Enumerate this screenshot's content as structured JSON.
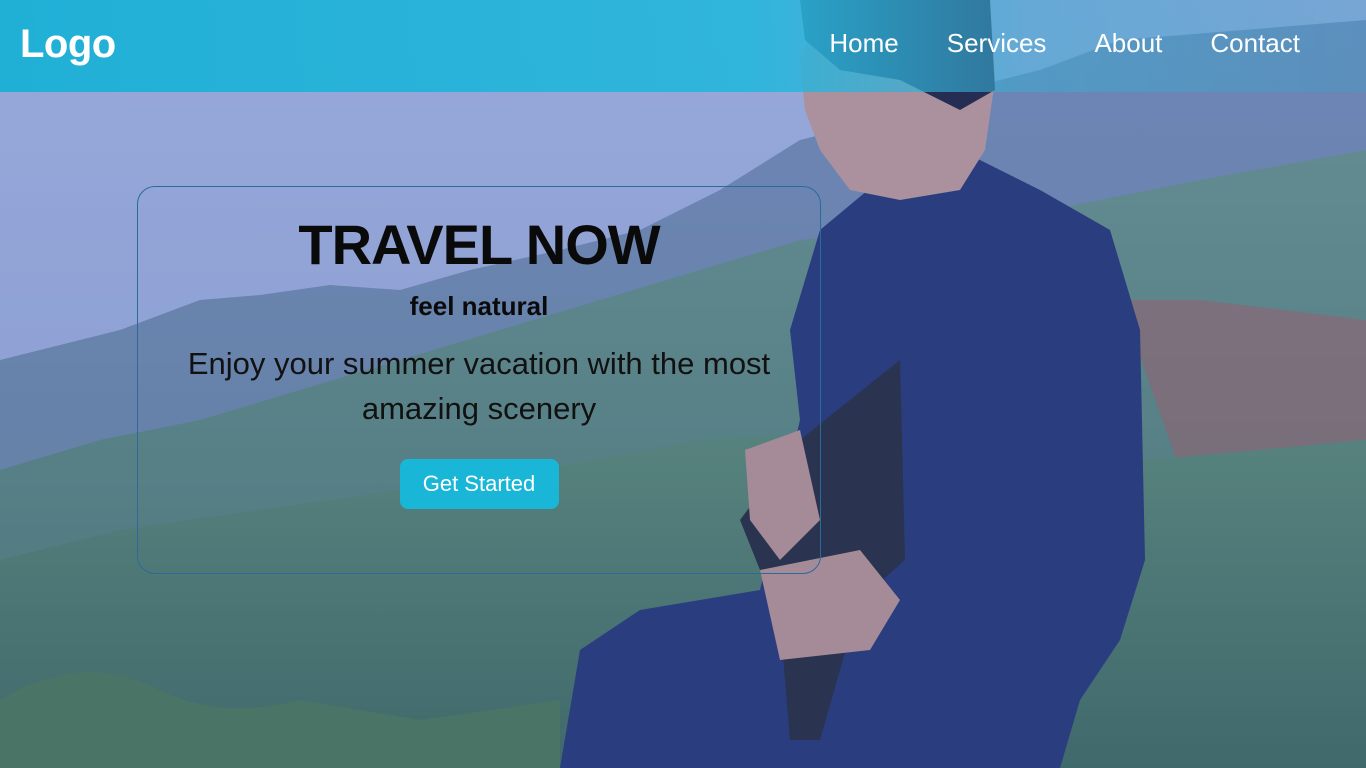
{
  "navbar": {
    "logo": "Logo",
    "links": [
      "Home",
      "Services",
      "About",
      "Contact"
    ]
  },
  "hero": {
    "title": "TRAVEL NOW",
    "subtitle": "feel natural",
    "text": "Enjoy your summer vacation with the most amazing scenery",
    "button_label": "Get Started"
  },
  "colors": {
    "navbar": "#1cb0d6",
    "button": "#1ab6d8",
    "card_border": "#2a6b9b"
  }
}
